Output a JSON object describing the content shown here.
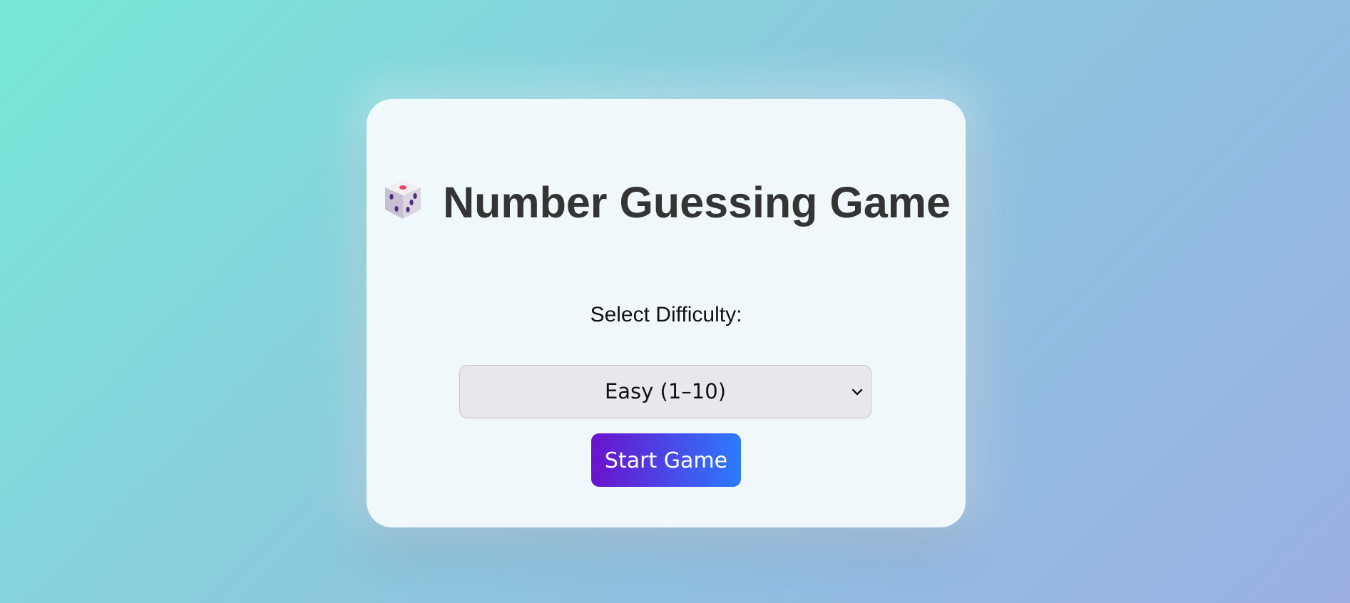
{
  "game": {
    "title": "Number Guessing Game",
    "difficulty_label": "Select Difficulty:",
    "difficulty_selected": "Easy (1–10)",
    "start_button": "Start Game",
    "title_icon": "dice-icon"
  },
  "colors": {
    "button_gradient_start": "#6a12cc",
    "button_gradient_end": "#2c7bff",
    "title_color": "#343434"
  }
}
